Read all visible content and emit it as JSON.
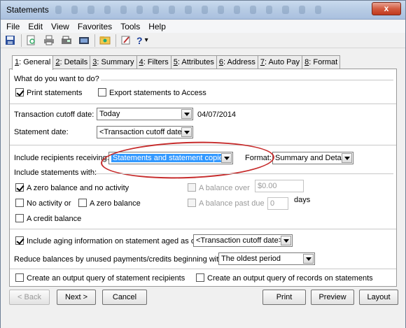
{
  "window": {
    "title": "Statements",
    "close_label": "x"
  },
  "menu": [
    "File",
    "Edit",
    "View",
    "Favorites",
    "Tools",
    "Help"
  ],
  "toolbar": {
    "help_label": "?",
    "dropdown_label": "▾"
  },
  "tabs": [
    {
      "key": "1",
      "label": ": General",
      "active": true
    },
    {
      "key": "2",
      "label": ": Details"
    },
    {
      "key": "3",
      "label": ": Summary"
    },
    {
      "key": "4",
      "label": ": Filters"
    },
    {
      "key": "5",
      "label": ": Attributes"
    },
    {
      "key": "6",
      "label": ": Address"
    },
    {
      "key": "7",
      "label": ": Auto Pay"
    },
    {
      "key": "8",
      "label": ": Format"
    }
  ],
  "general": {
    "what_heading": "What do you want to do?",
    "print_statements": {
      "label": "Print statements",
      "checked": true
    },
    "export_statements": {
      "label": "Export statements to Access",
      "checked": false
    },
    "cutoff_label": "Transaction cutoff date:",
    "cutoff_value": "Today",
    "cutoff_date": "04/07/2014",
    "statement_date_label": "Statement date:",
    "statement_date_value": "<Transaction cutoff date>",
    "include_recipients_label": "Include recipients receiving:",
    "include_recipients_value": "Statements and statement copies",
    "format_label": "Format:",
    "format_value": "Summary and Detail",
    "include_with_label": "Include statements with:",
    "zero_balance_no_activity": {
      "label": "A zero balance and no activity",
      "checked": true
    },
    "balance_over": {
      "label": "A balance over",
      "value": "$0.00",
      "checked": false
    },
    "no_activity_or": {
      "label": "No activity or",
      "checked": false
    },
    "a_zero_balance": {
      "label": "A zero balance",
      "checked": false
    },
    "balance_past_due": {
      "label": "A balance past due",
      "value": "0",
      "unit": "days",
      "checked": false
    },
    "credit_balance": {
      "label": "A credit balance",
      "checked": false
    },
    "aging_label": "Include aging information on statement aged as of:",
    "aging_checked": true,
    "aging_value": "<Transaction cutoff date>",
    "reduce_label": "Reduce balances by unused payments/credits beginning with:",
    "reduce_value": "The oldest period",
    "output_query_recipients": {
      "label": "Create an output query of statement recipients",
      "checked": false
    },
    "output_query_records": {
      "label": "Create an output query of records on statements",
      "checked": false
    }
  },
  "buttons": {
    "back": "< Back",
    "next": "Next >",
    "cancel": "Cancel",
    "print": "Print",
    "preview": "Preview",
    "layout": "Layout"
  }
}
